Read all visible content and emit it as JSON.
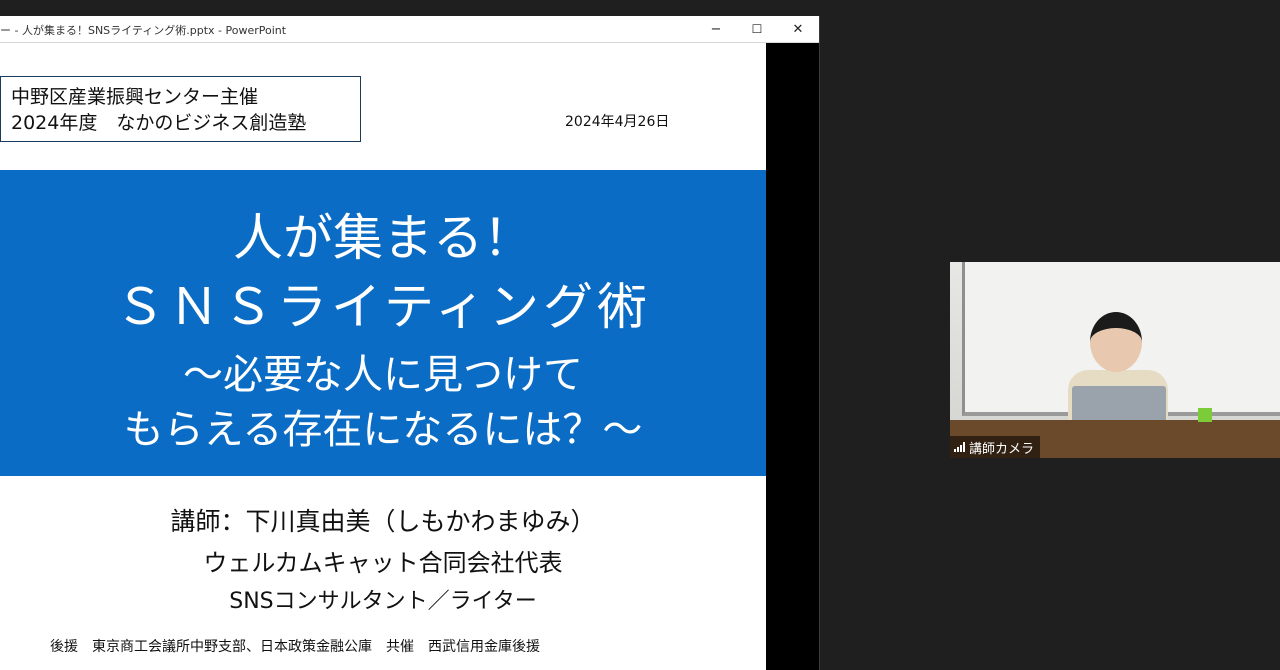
{
  "window": {
    "title": "ー - 人が集まる！SNSライティング術.pptx - PowerPoint",
    "minimize_glyph": "−",
    "maximize_glyph": "☐",
    "close_glyph": "✕"
  },
  "slide": {
    "organizer_line1": "中野区産業振興センター主催",
    "organizer_line2": "2024年度　なかのビジネス創造塾",
    "date": "2024年4月26日",
    "title_line1": "人が集まる！",
    "title_line2": "ＳＮＳライティング術",
    "subtitle_line1": "～必要な人に見つけて",
    "subtitle_line2": "もらえる存在になるには？～",
    "presenter_line1": "講師：下川真由美（しもかわまゆみ）",
    "presenter_line2": "ウェルカムキャット合同会社代表",
    "presenter_line3": "SNSコンサルタント／ライター",
    "support_line": "後援　東京商工会議所中野支部、日本政策金融公庫　共催　西武信用金庫後援"
  },
  "camera": {
    "label": "講師カメラ",
    "icon": "signal-bars-icon"
  },
  "colors": {
    "banner": "#0a6cc4",
    "background": "#1f1f1f"
  }
}
